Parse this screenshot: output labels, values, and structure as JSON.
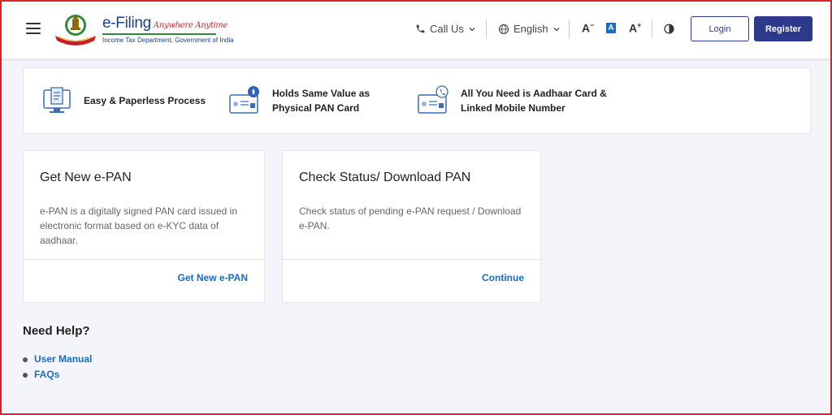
{
  "header": {
    "logo_title": "e-Filing",
    "logo_tagline": "Anywhere Anytime",
    "logo_subtitle": "Income Tax Department, Government of India",
    "call_us": "Call Us",
    "language": "English",
    "font_decrease": "A",
    "font_normal": "A",
    "font_increase": "A",
    "login_label": "Login",
    "register_label": "Register"
  },
  "features": [
    {
      "text_line1": "Easy & Paperless Process",
      "text_line2": "",
      "icon": "computer-document-icon"
    },
    {
      "text_line1": "Holds Same Value as",
      "text_line2": "Physical PAN Card",
      "icon": "pan-card-icon"
    },
    {
      "text_line1": "All You Need is Aadhaar Card &",
      "text_line2": "Linked Mobile Number",
      "icon": "aadhaar-card-phone-icon"
    }
  ],
  "cards": [
    {
      "title": "Get New e-PAN",
      "desc_line1": "e-PAN is a digitally signed PAN card issued in",
      "desc_line2": "electronic format based on e-KYC data of",
      "desc_line3": "aadhaar.",
      "link": "Get New e-PAN"
    },
    {
      "title": "Check Status/ Download PAN",
      "desc_line1": "Check status of pending e-PAN request / Download",
      "desc_line2": "e-PAN.",
      "desc_line3": "",
      "link": "Continue"
    }
  ],
  "help": {
    "title": "Need Help?",
    "items": [
      "User Manual",
      "FAQs"
    ]
  },
  "colors": {
    "primary": "#2d3a8c",
    "link": "#1b6bbd",
    "frame": "#d8232a",
    "background": "#f4f5fa"
  }
}
